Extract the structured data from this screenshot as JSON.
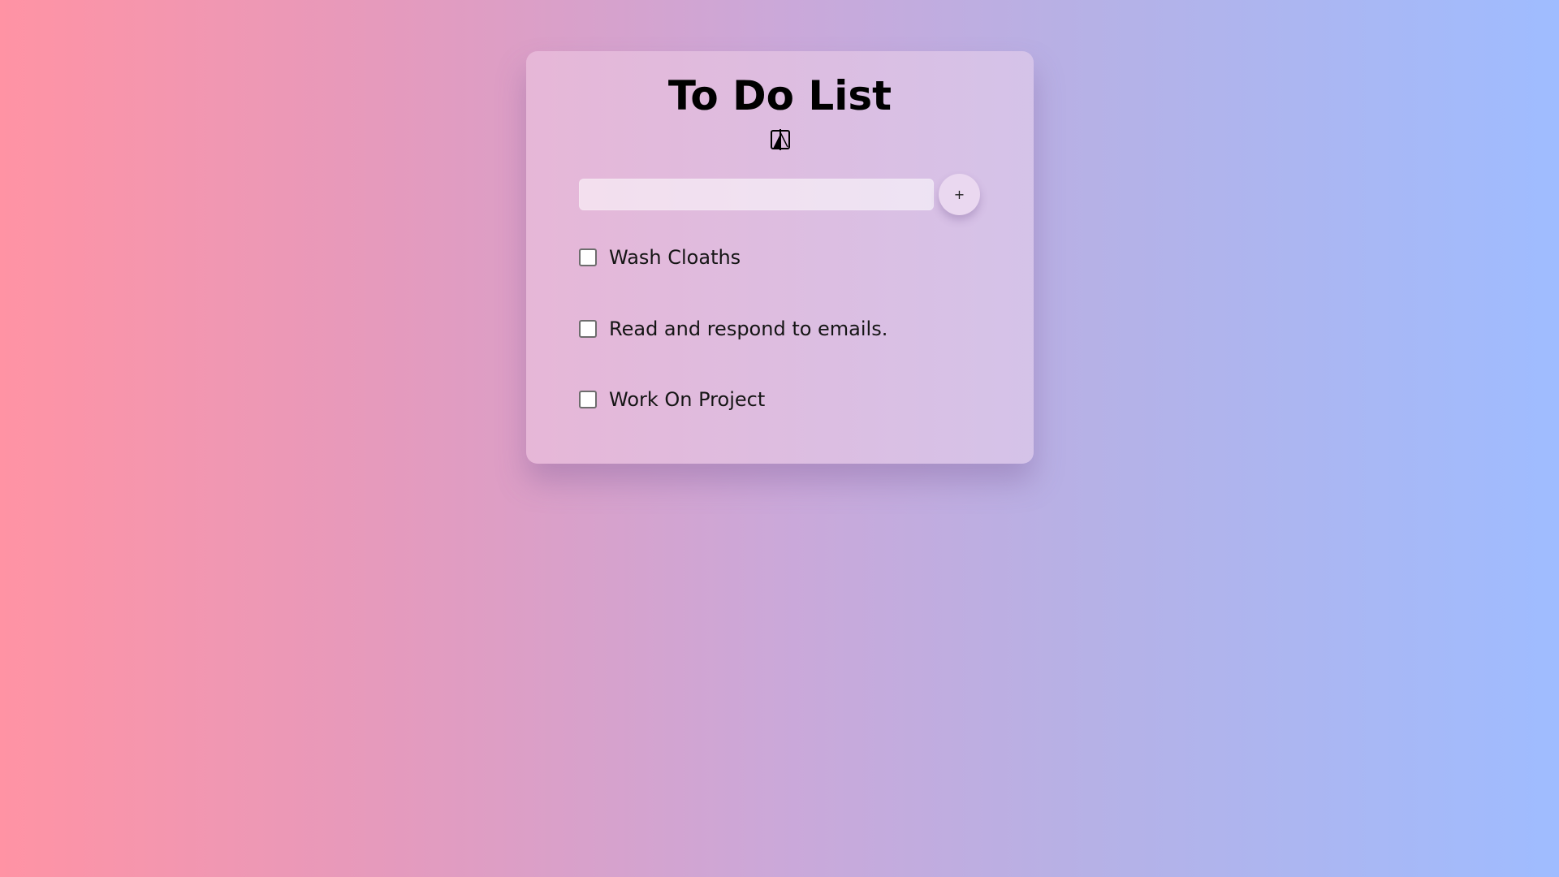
{
  "app": {
    "title": "To Do List"
  },
  "theme_toggle": {
    "icon": "contrast-toggle-icon"
  },
  "new_task": {
    "value": "",
    "placeholder": ""
  },
  "add_button": {
    "label": "+"
  },
  "tasks": [
    {
      "text": "Wash Cloaths",
      "checked": false
    },
    {
      "text": "Read and respond to emails.",
      "checked": false
    },
    {
      "text": "Work On Project",
      "checked": false
    }
  ],
  "colors": {
    "background_left": "#ff93a4",
    "background_right": "#9fbcff",
    "text": "#000000"
  }
}
